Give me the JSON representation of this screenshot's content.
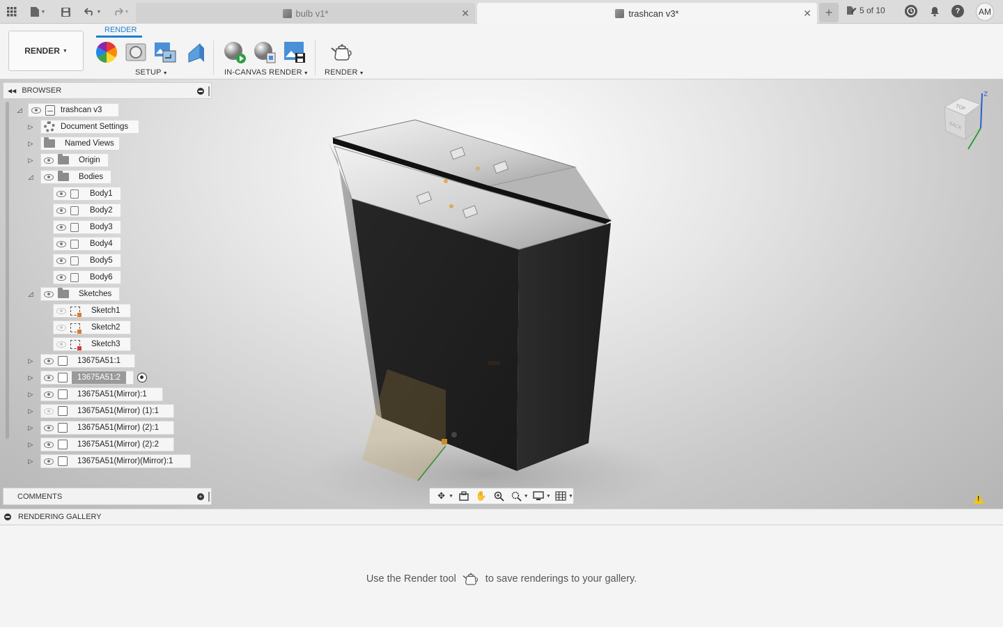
{
  "titlebar": {
    "tabs": [
      {
        "title": "bulb v1*",
        "active": false
      },
      {
        "title": "trashcan v3*",
        "active": true
      }
    ],
    "job_status": "5 of 10",
    "user_initials": "AM"
  },
  "toolbar": {
    "workspace": "RENDER",
    "tab_label": "RENDER",
    "groups": {
      "setup": "SETUP",
      "in_canvas": "IN-CANVAS RENDER",
      "render": "RENDER"
    }
  },
  "browser": {
    "title": "BROWSER",
    "root": "trashcan v3",
    "document_settings": "Document Settings",
    "named_views": "Named Views",
    "origin": "Origin",
    "bodies": "Bodies",
    "body_items": [
      "Body1",
      "Body2",
      "Body3",
      "Body4",
      "Body5",
      "Body6"
    ],
    "sketches": "Sketches",
    "sketch_items": [
      "Sketch1",
      "Sketch2",
      "Sketch3"
    ],
    "components": [
      "13675A51:1",
      "13675A51:2",
      "13675A51(Mirror):1",
      "13675A51(Mirror) (1):1",
      "13675A51(Mirror) (2):1",
      "13675A51(Mirror) (2):2",
      "13675A51(Mirror)(Mirror):1"
    ]
  },
  "comments": {
    "title": "COMMENTS"
  },
  "gallery": {
    "title": "RENDERING GALLERY",
    "message_before": "Use the Render tool",
    "message_after": "to save renderings to your gallery."
  },
  "viewcube": {
    "top": "TOP",
    "back": "BACK",
    "axis_z": "Z"
  },
  "colors": {
    "accent": "#1a7fd0",
    "panel": "#f2f2f2",
    "selected": "#9a9a9a"
  }
}
